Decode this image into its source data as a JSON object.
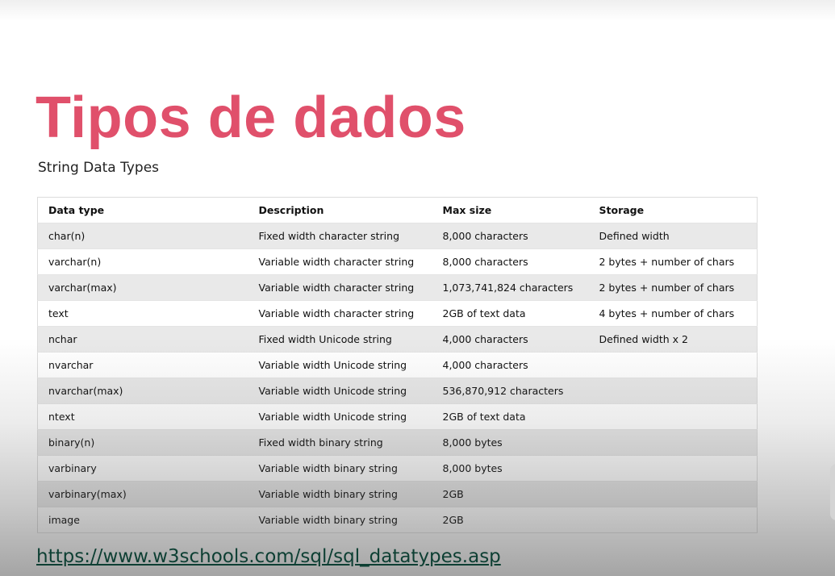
{
  "slide": {
    "title": "Tipos de dados",
    "subtitle": "String Data Types",
    "link": "https://www.w3schools.com/sql/sql_datatypes.asp"
  },
  "table": {
    "headers": [
      "Data type",
      "Description",
      "Max size",
      "Storage"
    ],
    "rows": [
      [
        "char(n)",
        "Fixed width character string",
        "8,000 characters",
        "Defined width"
      ],
      [
        "varchar(n)",
        "Variable width character string",
        "8,000 characters",
        "2 bytes + number of chars"
      ],
      [
        "varchar(max)",
        "Variable width character string",
        "1,073,741,824 characters",
        "2 bytes + number of chars"
      ],
      [
        "text",
        "Variable width character string",
        "2GB of text data",
        "4 bytes + number of chars"
      ],
      [
        "nchar",
        "Fixed width Unicode string",
        "4,000 characters",
        "Defined width x 2"
      ],
      [
        "nvarchar",
        "Variable width Unicode string",
        "4,000 characters",
        ""
      ],
      [
        "nvarchar(max)",
        "Variable width Unicode string",
        "536,870,912 characters",
        ""
      ],
      [
        "ntext",
        "Variable width Unicode string",
        "2GB of text data",
        ""
      ],
      [
        "binary(n)",
        "Fixed width binary string",
        "8,000 bytes",
        ""
      ],
      [
        "varbinary",
        "Variable width binary string",
        "8,000 bytes",
        ""
      ],
      [
        "varbinary(max)",
        "Variable width binary string",
        "2GB",
        ""
      ],
      [
        "image",
        "Variable width binary string",
        "2GB",
        ""
      ]
    ]
  },
  "colors": {
    "title": "#e0506b",
    "link": "#0d3f33",
    "row_stripe": "#e9e9e9"
  }
}
